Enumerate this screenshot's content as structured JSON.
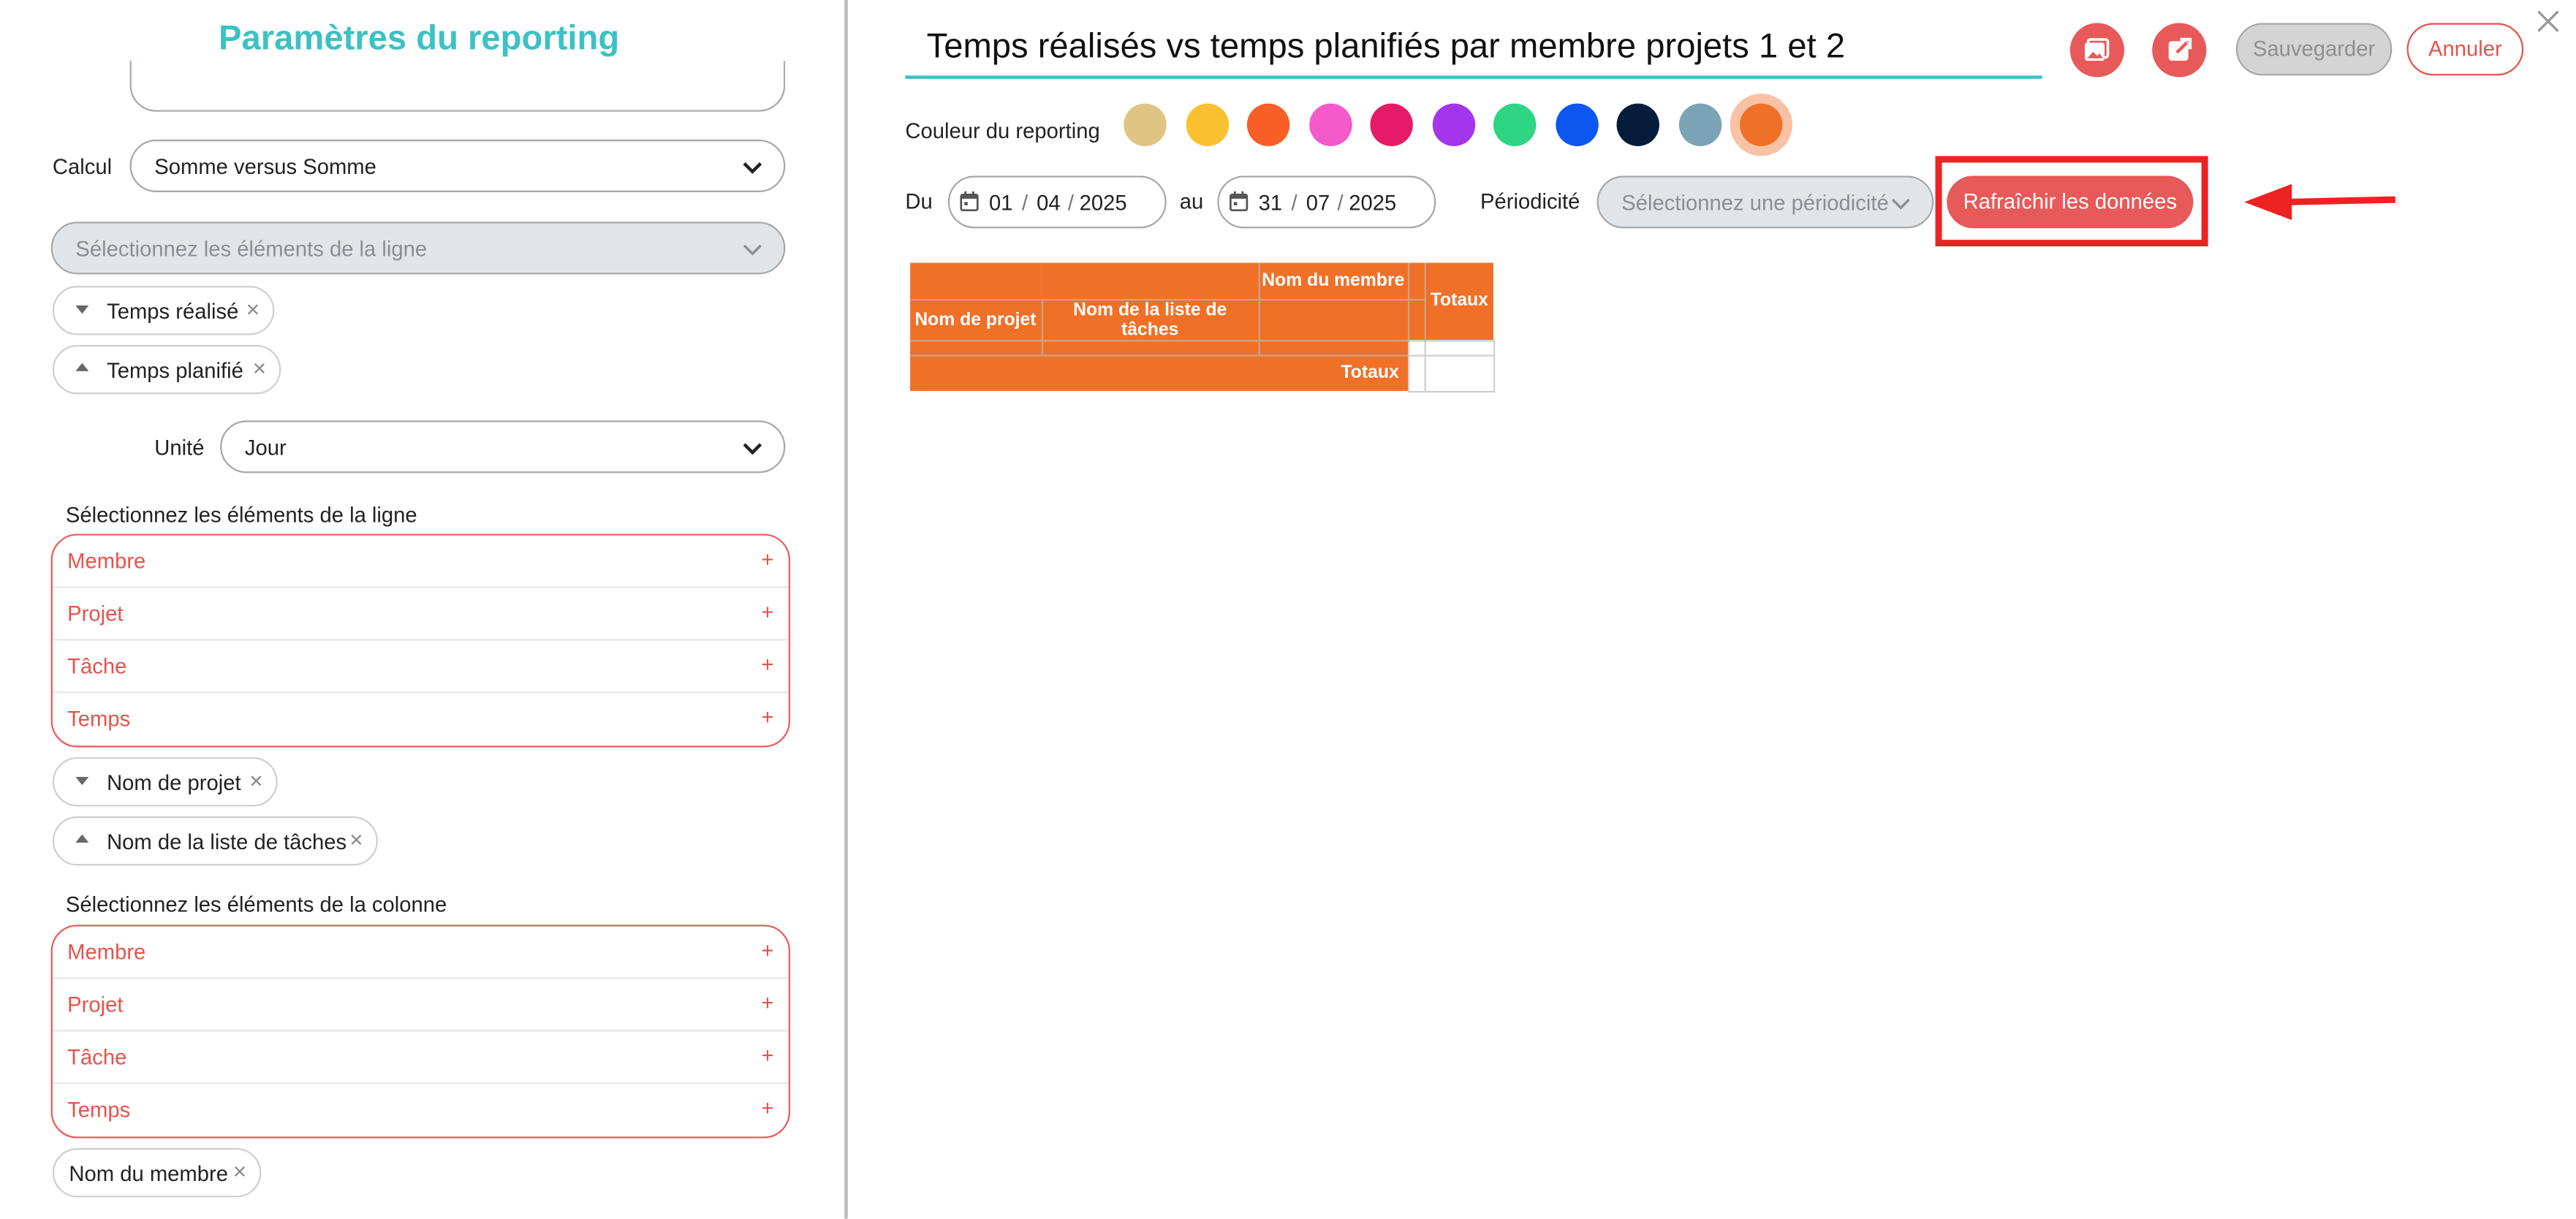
{
  "left_panel": {
    "title": "Paramètres du reporting",
    "calc_label": "Calcul",
    "calc_value": "Somme versus Somme",
    "line_select_placeholder": "Sélectionnez les éléments de la ligne",
    "measure_chips": [
      "Temps réalisé",
      "Temps planifié"
    ],
    "unit_label": "Unité",
    "unit_value": "Jour",
    "rows_section_label": "Sélectionnez les éléments de la ligne",
    "rows_options": [
      {
        "label": "Membre",
        "add": "+"
      },
      {
        "label": "Projet",
        "add": "+"
      },
      {
        "label": "Tâche",
        "add": "+"
      },
      {
        "label": "Temps",
        "add": "+"
      }
    ],
    "rows_chips": [
      "Nom de projet",
      "Nom de la liste de tâches"
    ],
    "cols_section_label": "Sélectionnez les éléments de la colonne",
    "cols_options": [
      {
        "label": "Membre",
        "add": "+"
      },
      {
        "label": "Projet",
        "add": "+"
      },
      {
        "label": "Tâche",
        "add": "+"
      },
      {
        "label": "Temps",
        "add": "+"
      }
    ],
    "cols_chips": [
      "Nom du membre"
    ],
    "chip_remove": "×"
  },
  "main": {
    "report_title": "Temps réalisés vs temps planifiés par membre projets 1 et 2",
    "save_label": "Sauvegarder",
    "cancel_label": "Annuler",
    "color_label": "Couleur du reporting",
    "colors": [
      "#e0c484",
      "#f9c12f",
      "#f75f26",
      "#f45ac9",
      "#e51b67",
      "#a335ec",
      "#2ed582",
      "#0b57f0",
      "#051c3b",
      "#7aa3b6",
      "#f07027"
    ],
    "selected_color": "#f07027",
    "from_label": "Du",
    "from_date": {
      "day": "01",
      "month": "04",
      "year": "2025"
    },
    "to_label": "au",
    "to_date": {
      "day": "31",
      "month": "07",
      "year": "2025"
    },
    "date_sep": "/",
    "period_label": "Périodicité",
    "period_placeholder": "Sélectionnez une périodicité",
    "refresh_label": "Rafraîchir les données"
  },
  "table": {
    "col_header": "Nom du membre",
    "totals_col": "Totaux",
    "row_headers": [
      "Nom de projet",
      "Nom de la liste de tâches"
    ],
    "totals_row": "Totaux"
  }
}
